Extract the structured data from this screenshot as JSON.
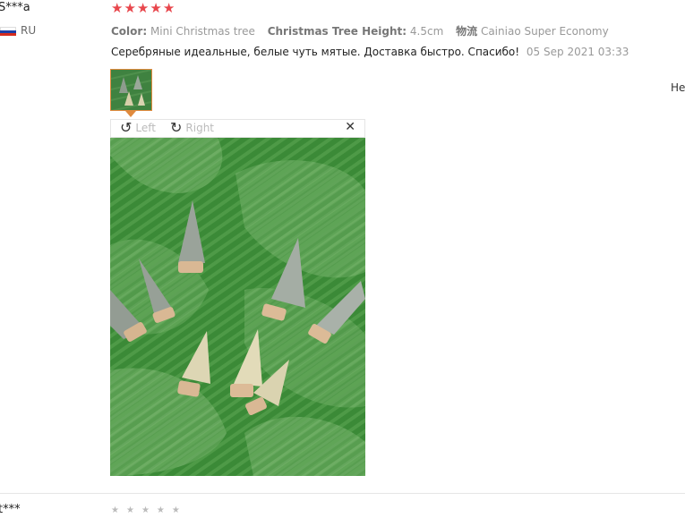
{
  "reviewer": {
    "name": "S***a",
    "country": "RU",
    "flag_colors": [
      "#ffffff",
      "#1c3fa8",
      "#d52b1e"
    ]
  },
  "rating": {
    "stars": 5,
    "max": 5,
    "star_glyph": "★",
    "color": "#e8464c"
  },
  "attributes": [
    {
      "key": "Color:",
      "value": "Mini Christmas tree"
    },
    {
      "key": "Christmas Tree Height:",
      "value": "4.5cm"
    },
    {
      "key": "物流",
      "value": "Cainiao Super Economy"
    }
  ],
  "review": {
    "text": "Серебряные идеальные, белые чуть мятые. Доставка быстро. Спасибо!",
    "date": "05 Sep 2021 03:33"
  },
  "right_cut_text": "He",
  "viewer": {
    "rotate_left_label": "Left",
    "rotate_right_label": "Right",
    "rotate_left_icon": "↺",
    "rotate_right_icon": "↻",
    "close_icon": "✕"
  },
  "next_review": {
    "name": "t***",
    "star_glyph": "★"
  },
  "colors": {
    "accent": "#e08a3e",
    "photo_green": "#3d8a3a"
  }
}
